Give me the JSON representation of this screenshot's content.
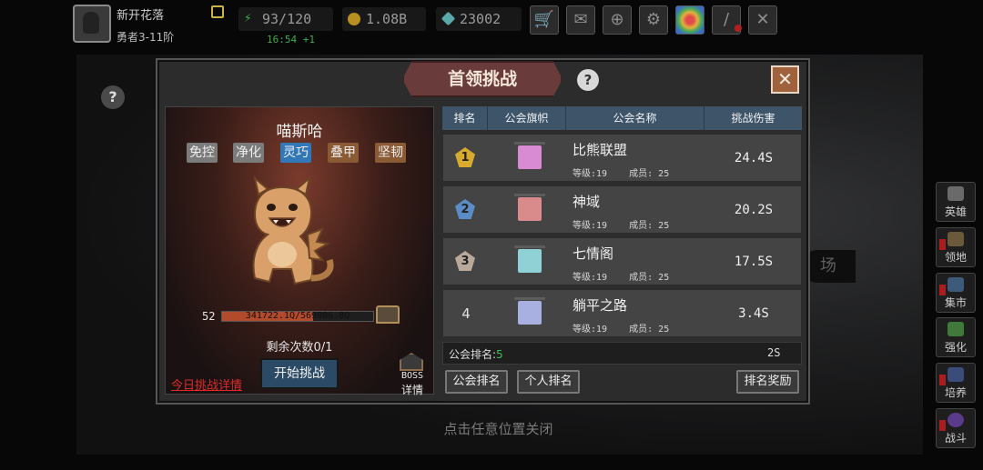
{
  "player": {
    "name": "新开花落",
    "rank": "勇者3-11阶"
  },
  "resources": {
    "energy": "93/120",
    "energy_timer": "16:54 +1",
    "gold": "1.08B",
    "gems": "23002"
  },
  "toolbar_icons": [
    "shop-cart-icon",
    "mail-icon",
    "gamepad-icon",
    "settings-gear-icon",
    "rainbow-wheel-icon",
    "sword-icon",
    "crossed-swords-icon"
  ],
  "side_menu": [
    {
      "label": "英雄",
      "icon": "hero-icon"
    },
    {
      "label": "领地",
      "icon": "territory-icon"
    },
    {
      "label": "集市",
      "icon": "market-icon"
    },
    {
      "label": "强化",
      "icon": "enhance-icon"
    },
    {
      "label": "培养",
      "icon": "train-icon"
    },
    {
      "label": "战斗",
      "icon": "battle-icon"
    }
  ],
  "background_place_label": "场",
  "close_hint": "点击任意位置关闭",
  "dialog": {
    "title": "首领挑战",
    "boss": {
      "name": "喵斯哈",
      "tags": [
        "免控",
        "净化",
        "灵巧",
        "叠甲",
        "坚韧"
      ],
      "level": "52",
      "hp_text": "341722.1Q/569986.8Q",
      "hp_fraction": 0.6,
      "remaining": "剩余次数0/1",
      "start_label": "开始挑战",
      "today_link": "今日挑战详情",
      "detail_top": "BOSS",
      "detail_bottom": "详情"
    },
    "table": {
      "headers": [
        "排名",
        "公会旗帜",
        "公会名称",
        "挑战伤害"
      ],
      "rows": [
        {
          "rank": "1",
          "name": "比熊联盟",
          "info": "等级:19    成员: 25",
          "damage": "24.4S"
        },
        {
          "rank": "2",
          "name": "神域",
          "info": "等级:19    成员: 25",
          "damage": "20.2S"
        },
        {
          "rank": "3",
          "name": "七情阁",
          "info": "等级:19    成员: 25",
          "damage": "17.5S"
        },
        {
          "rank": "4",
          "name": "躺平之路",
          "info": "等级:19    成员: 25",
          "damage": "3.4S"
        }
      ],
      "my_rank_label": "公会排名:",
      "my_rank_value": "5",
      "my_damage": "2S"
    },
    "buttons": {
      "guild_rank": "公会排名",
      "personal_rank": "个人排名",
      "rank_reward": "排名奖励"
    }
  },
  "colors": {
    "accent_green": "#3fbe4f",
    "link_red": "#e02a2a",
    "table_header": "#3e5468",
    "title_plate": "#6a3b3b"
  }
}
